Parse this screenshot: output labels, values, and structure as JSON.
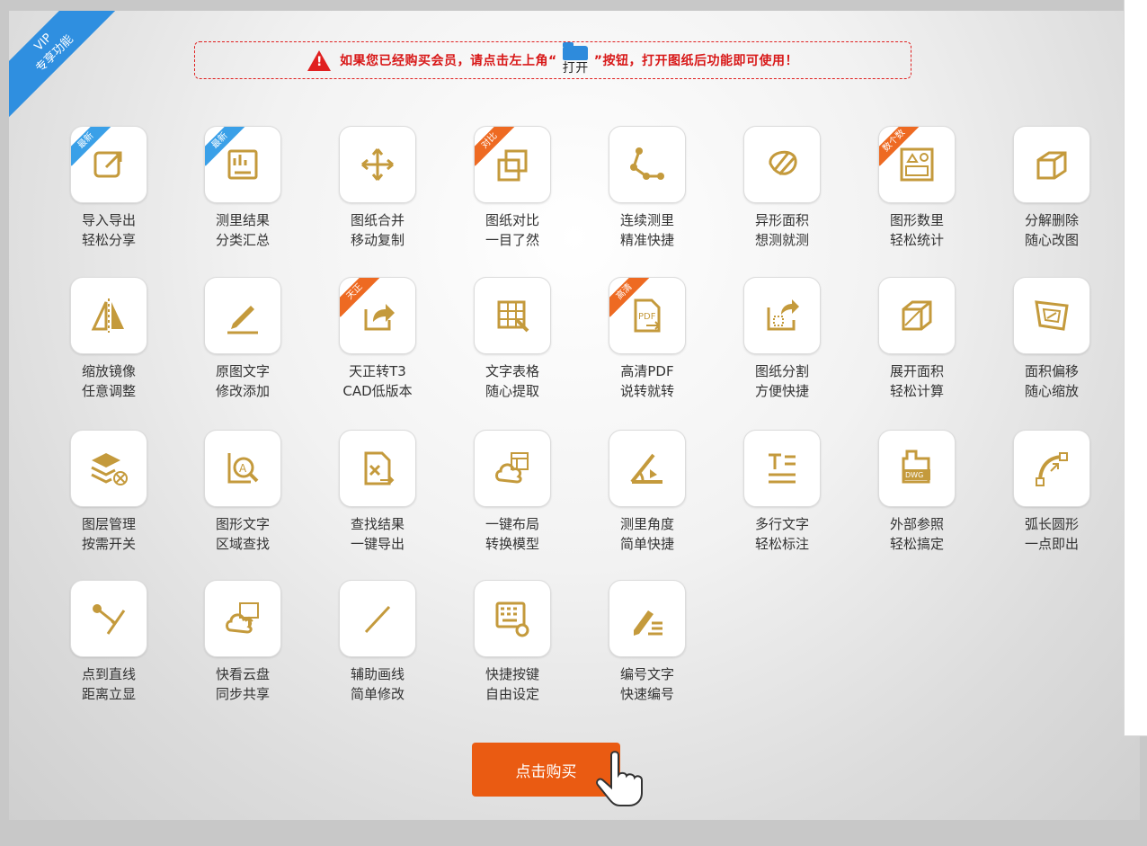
{
  "vip_ribbon": {
    "line1": "VIP",
    "line2": "专享功能"
  },
  "notice": {
    "text_before": "如果您已经购买会员，请点击左上角“",
    "open_label": "打开",
    "text_after": "”按钮，打开图纸后功能即可使用！"
  },
  "buy_button": {
    "label": "点击购买"
  },
  "colors": {
    "icon_gold": "#c49a3c",
    "accent_orange": "#ea5b12",
    "ribbon_blue": "#2f8fe0",
    "notice_red": "#d81818"
  },
  "features": [
    {
      "line1": "导入导出",
      "line2": "轻松分享",
      "badge": "最新",
      "badge_color": "blue",
      "icon": "export-icon"
    },
    {
      "line1": "测里结果",
      "line2": "分类汇总",
      "badge": "最新",
      "badge_color": "blue",
      "icon": "measure-summary-icon"
    },
    {
      "line1": "图纸合并",
      "line2": "移动复制",
      "badge": "",
      "badge_color": "",
      "icon": "move-arrows-icon"
    },
    {
      "line1": "图纸对比",
      "line2": "一目了然",
      "badge": "对比",
      "badge_color": "orange",
      "icon": "compare-squares-icon"
    },
    {
      "line1": "连续测里",
      "line2": "精准快捷",
      "badge": "",
      "badge_color": "",
      "icon": "polyline-measure-icon"
    },
    {
      "line1": "异形面积",
      "line2": "想测就测",
      "badge": "",
      "badge_color": "",
      "icon": "irregular-area-icon"
    },
    {
      "line1": "图形数里",
      "line2": "轻松统计",
      "badge": "数个数",
      "badge_color": "orange",
      "icon": "shape-count-icon"
    },
    {
      "line1": "分解删除",
      "line2": "随心改图",
      "badge": "",
      "badge_color": "",
      "icon": "explode-cube-icon"
    },
    {
      "line1": "缩放镜像",
      "line2": "任意调整",
      "badge": "",
      "badge_color": "",
      "icon": "mirror-icon"
    },
    {
      "line1": "原图文字",
      "line2": "修改添加",
      "badge": "",
      "badge_color": "",
      "icon": "pencil-icon"
    },
    {
      "line1": "天正转T3",
      "line2": "CAD低版本",
      "badge": "天正",
      "badge_color": "orange",
      "icon": "convert-share-icon"
    },
    {
      "line1": "文字表格",
      "line2": "随心提取",
      "badge": "",
      "badge_color": "",
      "icon": "table-extract-icon"
    },
    {
      "line1": "高清PDF",
      "line2": "说转就转",
      "badge": "高清",
      "badge_color": "orange",
      "icon": "pdf-icon"
    },
    {
      "line1": "图纸分割",
      "line2": "方便快捷",
      "badge": "",
      "badge_color": "",
      "icon": "split-drawing-icon"
    },
    {
      "line1": "展开面积",
      "line2": "轻松计算",
      "badge": "",
      "badge_color": "",
      "icon": "unfold-area-icon"
    },
    {
      "line1": "面积偏移",
      "line2": "随心缩放",
      "badge": "",
      "badge_color": "",
      "icon": "area-offset-icon"
    },
    {
      "line1": "图层管理",
      "line2": "按需开关",
      "badge": "",
      "badge_color": "",
      "icon": "layers-icon"
    },
    {
      "line1": "图形文字",
      "line2": "区域查找",
      "badge": "",
      "badge_color": "",
      "icon": "text-search-icon"
    },
    {
      "line1": "查找结果",
      "line2": "一键导出",
      "badge": "",
      "badge_color": "",
      "icon": "export-result-icon"
    },
    {
      "line1": "一键布局",
      "line2": "转换模型",
      "badge": "",
      "badge_color": "",
      "icon": "cloud-layout-icon"
    },
    {
      "line1": "测里角度",
      "line2": "简单快捷",
      "badge": "",
      "badge_color": "",
      "icon": "angle-icon"
    },
    {
      "line1": "多行文字",
      "line2": "轻松标注",
      "badge": "",
      "badge_color": "",
      "icon": "multiline-text-icon"
    },
    {
      "line1": "外部参照",
      "line2": "轻松搞定",
      "badge": "",
      "badge_color": "",
      "icon": "dwg-reference-icon"
    },
    {
      "line1": "弧长圆形",
      "line2": "一点即出",
      "badge": "",
      "badge_color": "",
      "icon": "arc-length-icon"
    },
    {
      "line1": "点到直线",
      "line2": "距离立显",
      "badge": "",
      "badge_color": "",
      "icon": "point-line-icon"
    },
    {
      "line1": "快看云盘",
      "line2": "同步共享",
      "badge": "",
      "badge_color": "",
      "icon": "cloud-upload-icon"
    },
    {
      "line1": "辅助画线",
      "line2": "简单修改",
      "badge": "",
      "badge_color": "",
      "icon": "draw-line-icon"
    },
    {
      "line1": "快捷按键",
      "line2": "自由设定",
      "badge": "",
      "badge_color": "",
      "icon": "keyboard-gear-icon"
    },
    {
      "line1": "编号文字",
      "line2": "快速编号",
      "badge": "",
      "badge_color": "",
      "icon": "numbered-text-icon"
    }
  ]
}
